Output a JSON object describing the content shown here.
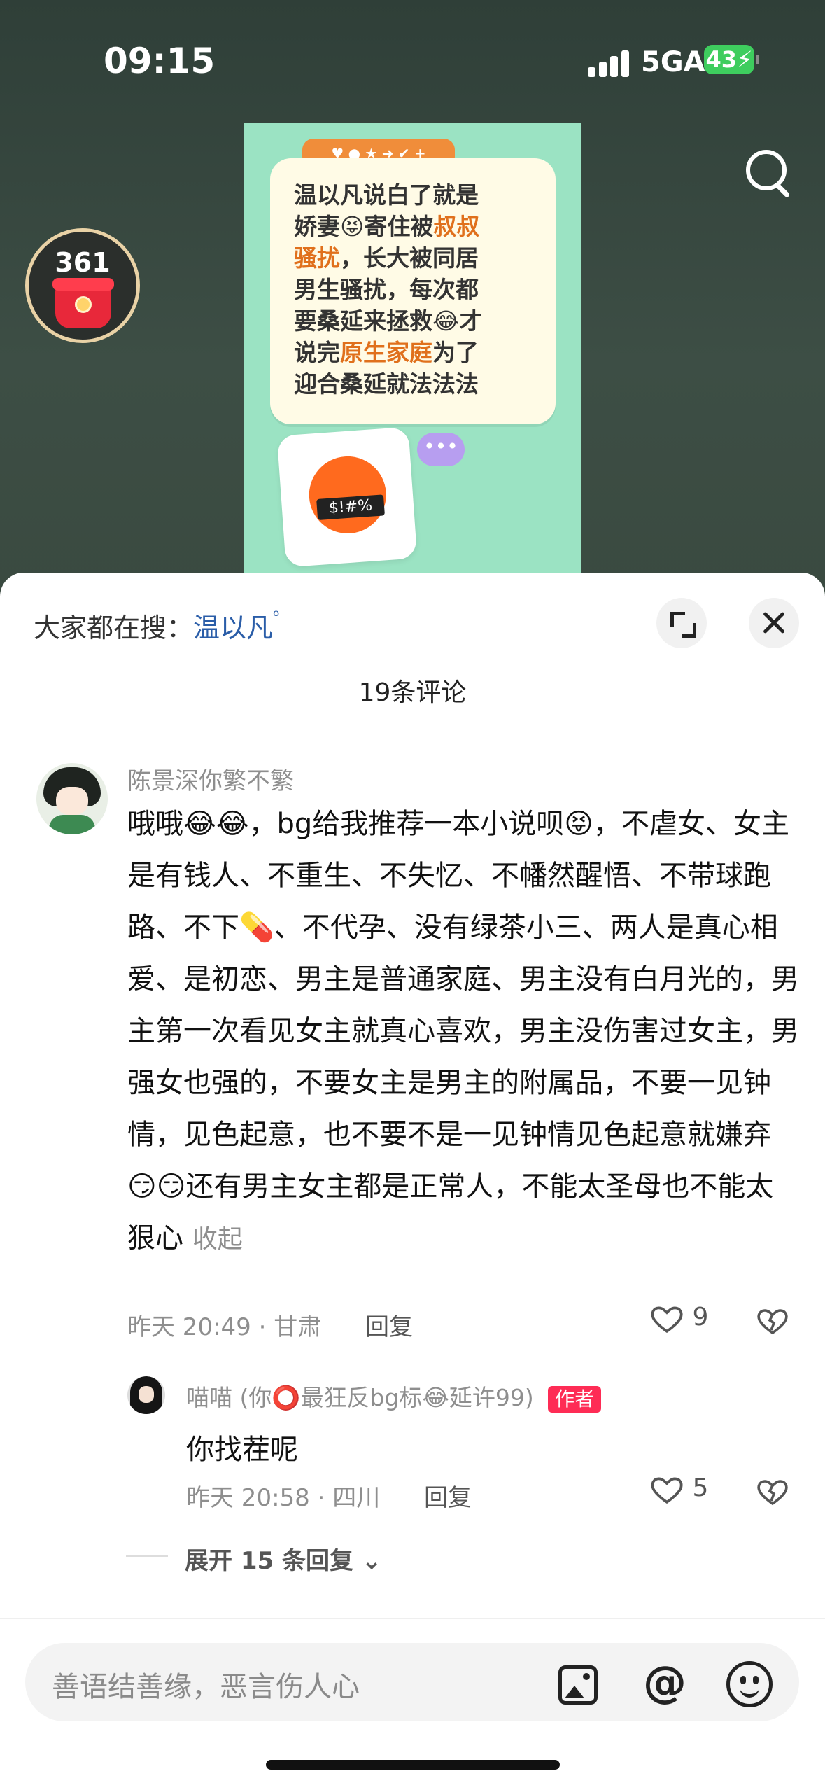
{
  "status_bar": {
    "time": "09:15",
    "network": "5GA",
    "battery": "43"
  },
  "coin_badge": {
    "count": "361"
  },
  "video_thumb": {
    "toolbar_icons": "♥ ● ★ ➜ ✔ +",
    "lines": [
      [
        {
          "t": "温以凡说白了就是"
        }
      ],
      [
        {
          "t": "娇妻😝寄住被"
        },
        {
          "t": "叔叔",
          "hl": true
        }
      ],
      [
        {
          "t": "骚扰",
          "hl": true
        },
        {
          "t": "，长大被同居"
        }
      ],
      [
        {
          "t": "男生骚扰，每次都"
        }
      ],
      [
        {
          "t": "要桑延来拯救😂才"
        }
      ],
      [
        {
          "t": "说完"
        },
        {
          "t": "原生家庭",
          "hl": true
        },
        {
          "t": "为了"
        }
      ],
      [
        {
          "t": "迎合桑延就法法法"
        }
      ]
    ],
    "mask_text": "$!#%",
    "chat_dots": "•••"
  },
  "sheet": {
    "hot_search_prefix": "大家都在搜：",
    "hot_search_keyword": "温以凡",
    "comment_count": "19条评论",
    "comment": {
      "username": "陈景深你繁不繁",
      "text": "哦哦😂😂，bg给我推荐一本小说呗😝，不虐女、女主是有钱人、不重生、不失忆、不幡然醒悟、不带球跑路、不下💊、不代孕、没有绿茶小三、两人是真心相爱、是初恋、男主是普通家庭、男主没有白月光的，男主第一次看见女主就真心喜欢，男主没伤害过女主，男强女也强的，不要女主是男主的附属品，不要一见钟情，见色起意，也不要不是一见钟情见色起意就嫌弃😏😏还有男主女主都是正常人，不能太圣母也不能太狠心",
      "fold_label": "收起",
      "meta": "昨天 20:49 · 甘肃",
      "reply_label": "回复",
      "likes": "9"
    },
    "reply": {
      "username": "喵喵 (你⭕最狂反bg标😂延许99)",
      "author_tag": "作者",
      "text": "你找茬呢",
      "meta": "昨天 20:58 · 四川",
      "reply_label": "回复",
      "likes": "5"
    },
    "expand_replies": "展开 15 条回复 ⌄"
  },
  "composer": {
    "placeholder": "善语结善缘，恶言伤人心",
    "at_symbol": "@"
  },
  "colors": {
    "accent_red": "#fe2c55",
    "keyword_blue": "#2a5da8",
    "highlight_orange": "#e0701c"
  }
}
